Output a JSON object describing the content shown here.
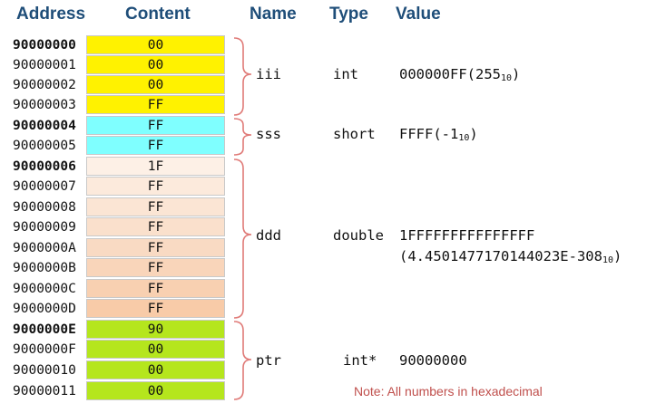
{
  "headers": {
    "address": "Address",
    "content": "Content",
    "name": "Name",
    "type": "Type",
    "value": "Value"
  },
  "rows": [
    {
      "address": "90000000",
      "content": "00"
    },
    {
      "address": "90000001",
      "content": "00"
    },
    {
      "address": "90000002",
      "content": "00"
    },
    {
      "address": "90000003",
      "content": "FF"
    },
    {
      "address": "90000004",
      "content": "FF"
    },
    {
      "address": "90000005",
      "content": "FF"
    },
    {
      "address": "90000006",
      "content": "1F"
    },
    {
      "address": "90000007",
      "content": "FF"
    },
    {
      "address": "90000008",
      "content": "FF"
    },
    {
      "address": "90000009",
      "content": "FF"
    },
    {
      "address": "9000000A",
      "content": "FF"
    },
    {
      "address": "9000000B",
      "content": "FF"
    },
    {
      "address": "9000000C",
      "content": "FF"
    },
    {
      "address": "9000000D",
      "content": "FF"
    },
    {
      "address": "9000000E",
      "content": "90"
    },
    {
      "address": "9000000F",
      "content": "00"
    },
    {
      "address": "90000010",
      "content": "00"
    },
    {
      "address": "90000011",
      "content": "00"
    }
  ],
  "variables": [
    {
      "name": "iii",
      "type": "int",
      "value": "000000FF(255",
      "value_sub": "10",
      "value_end": ")",
      "color": "#FFF200"
    },
    {
      "name": "sss",
      "type": "short",
      "value": "FFFF(-1",
      "value_sub": "10",
      "value_end": ")",
      "color": "#7FFFFF"
    },
    {
      "name": "ddd",
      "type": "double",
      "value": "1FFFFFFFFFFFFFFF",
      "value2": "(4.4501477170144023E-308",
      "value2_sub": "10",
      "value2_end": ")",
      "gradient": [
        "#FDEFE4",
        "#F8CBA8"
      ]
    },
    {
      "name": "ptr",
      "type": "int*",
      "value": "90000000",
      "color": "#B5E61D"
    }
  ],
  "note": "Note: All numbers in hexadecimal",
  "colors": {
    "bracket": "#E07B78",
    "header": "#1F4E79",
    "note": "#C0504D",
    "cell_border": "#c9c9c9"
  }
}
